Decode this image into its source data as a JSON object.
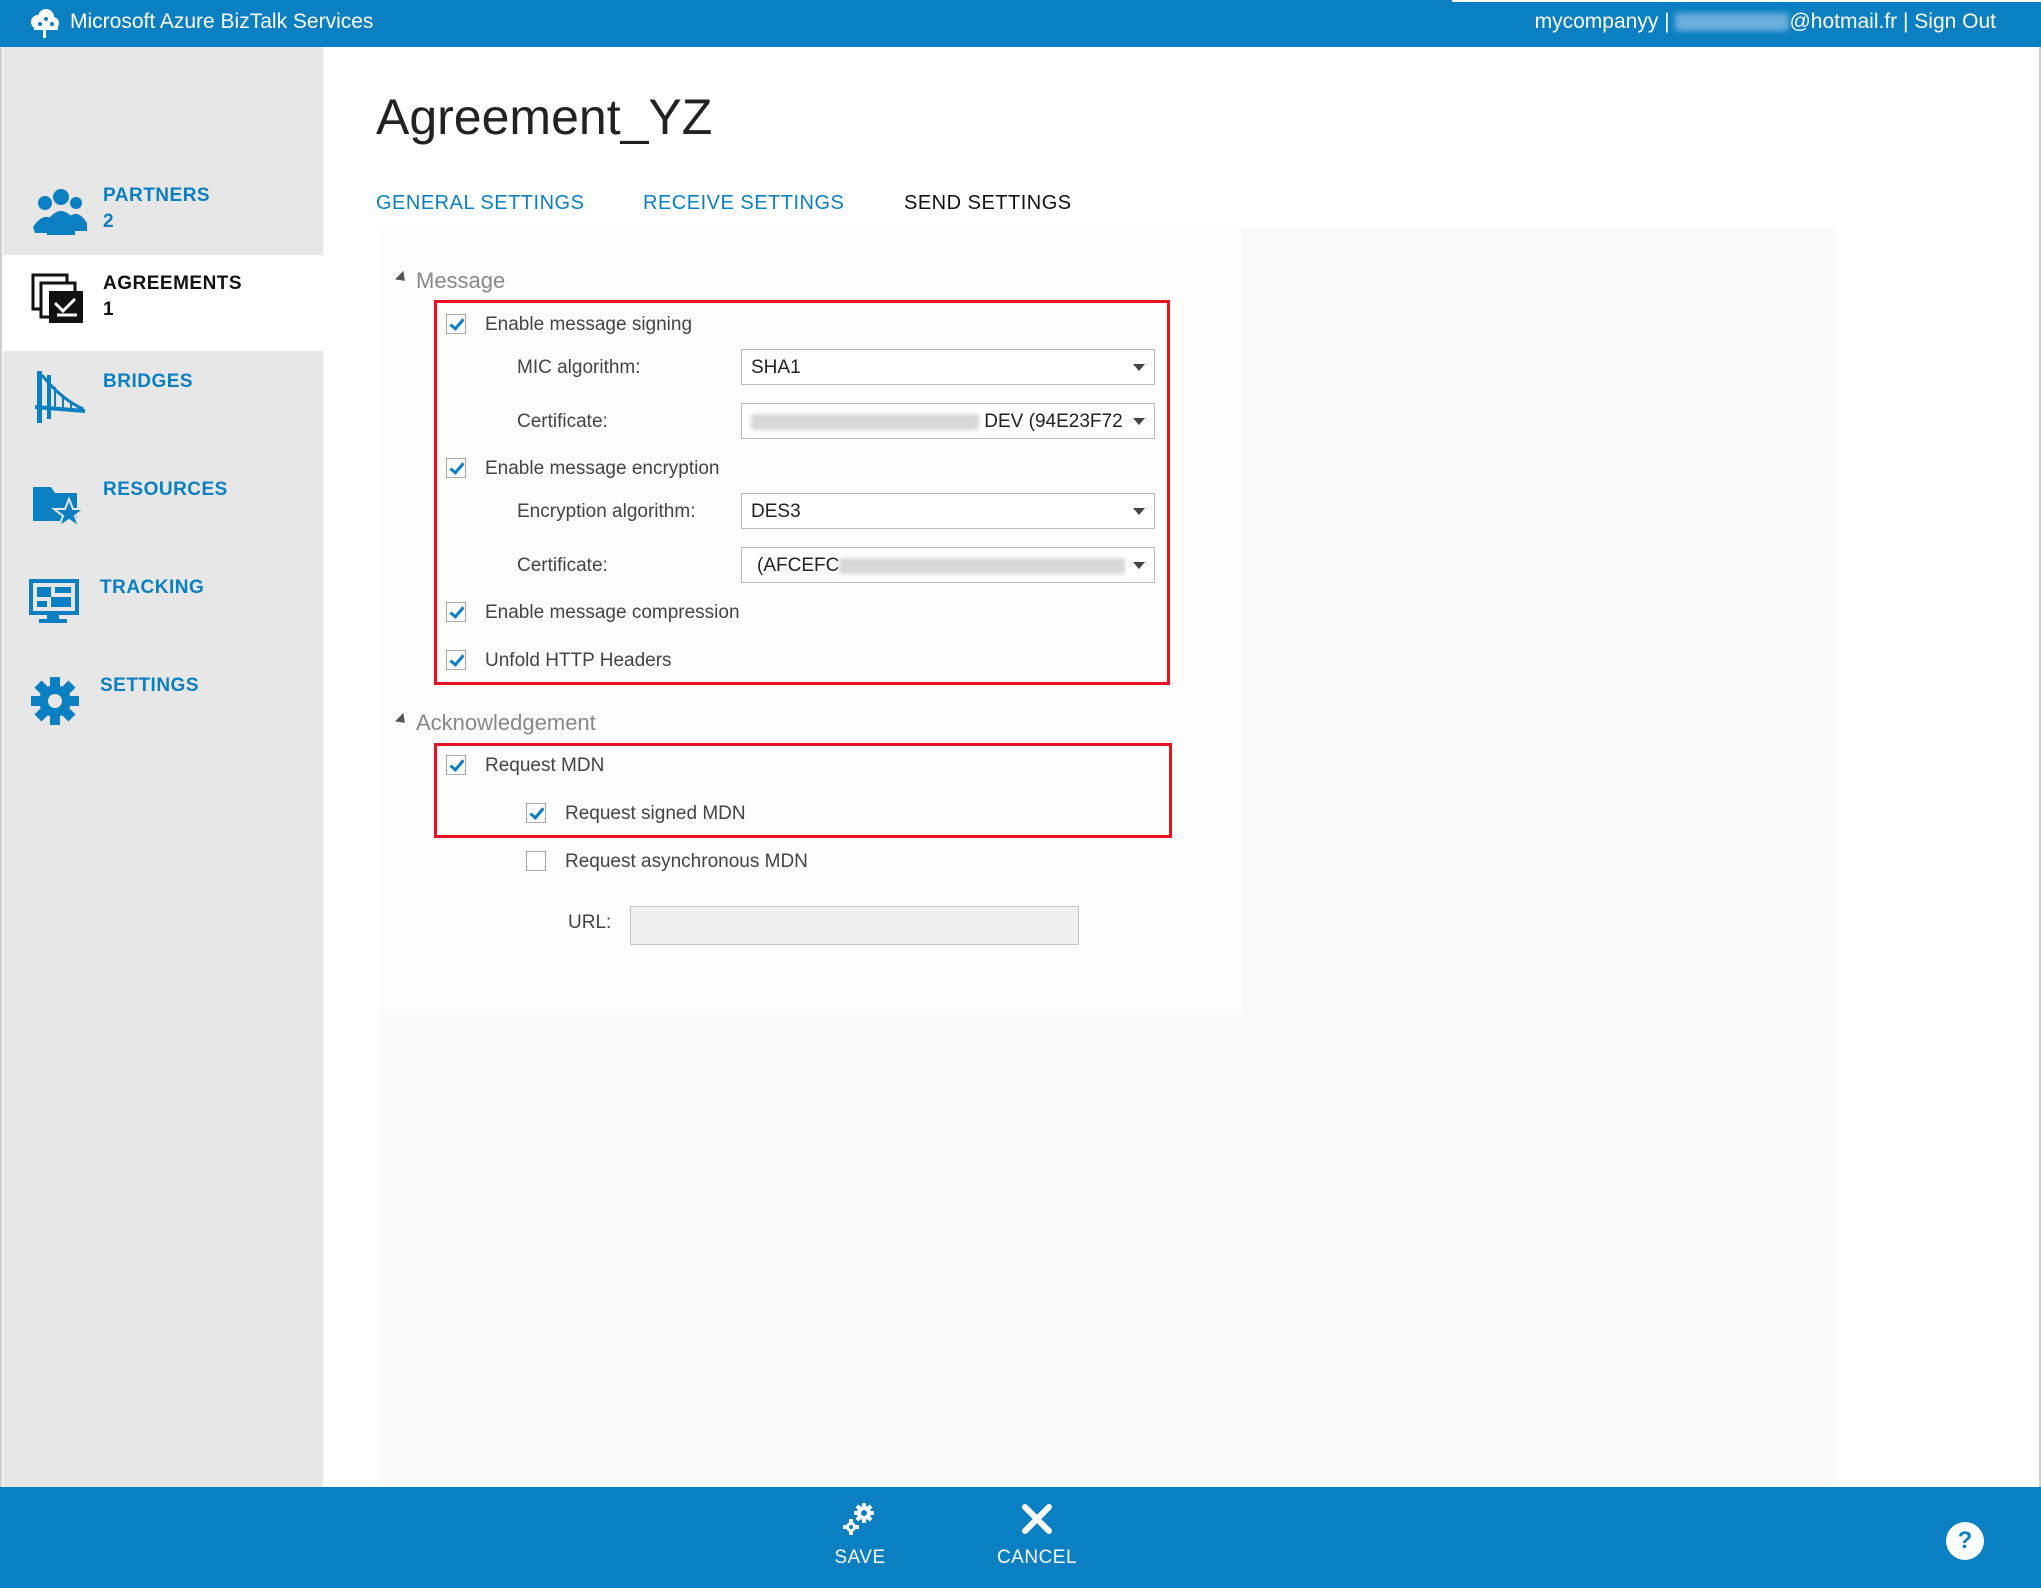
{
  "header": {
    "app_title": "Microsoft Azure BizTalk Services",
    "account_prefix": "mycompanyy |",
    "account_suffix": "@hotmail.fr |",
    "sign_out": "Sign Out"
  },
  "sidebar": {
    "items": [
      {
        "label": "PARTNERS",
        "count": "2",
        "icon": "partners-icon"
      },
      {
        "label": "AGREEMENTS",
        "count": "1",
        "icon": "agreements-icon",
        "active": true
      },
      {
        "label": "BRIDGES",
        "count": "",
        "icon": "bridge-icon"
      },
      {
        "label": "RESOURCES",
        "count": "",
        "icon": "resources-icon"
      },
      {
        "label": "TRACKING",
        "count": "",
        "icon": "tracking-icon"
      },
      {
        "label": "SETTINGS",
        "count": "",
        "icon": "gear-icon"
      }
    ]
  },
  "page": {
    "title": "Agreement_YZ",
    "tabs": [
      {
        "label": "GENERAL SETTINGS"
      },
      {
        "label": "RECEIVE SETTINGS"
      },
      {
        "label": "SEND SETTINGS",
        "active": true
      }
    ]
  },
  "message": {
    "section_title": "Message",
    "enable_signing": {
      "label": "Enable message signing",
      "checked": true
    },
    "mic_algorithm": {
      "label": "MIC algorithm:",
      "value": "SHA1"
    },
    "signing_certificate": {
      "label": "Certificate:",
      "value_visible": "DEV (94E23F72"
    },
    "enable_encryption": {
      "label": "Enable message encryption",
      "checked": true
    },
    "encryption_algorithm": {
      "label": "Encryption algorithm:",
      "value": "DES3"
    },
    "encryption_certificate": {
      "label": "Certificate:",
      "value_visible": "(AFCEFC"
    },
    "enable_compression": {
      "label": "Enable message compression",
      "checked": true
    },
    "unfold_headers": {
      "label": "Unfold HTTP Headers",
      "checked": true
    }
  },
  "acknowledgement": {
    "section_title": "Acknowledgement",
    "request_mdn": {
      "label": "Request MDN",
      "checked": true
    },
    "request_signed_mdn": {
      "label": "Request signed MDN",
      "checked": true
    },
    "request_async_mdn": {
      "label": "Request asynchronous MDN",
      "checked": false
    },
    "url": {
      "label": "URL:",
      "value": ""
    }
  },
  "footer": {
    "save": "SAVE",
    "cancel": "CANCEL",
    "help": "?"
  },
  "colors": {
    "accent": "#0a7fc1",
    "highlight": "#e81123",
    "sidebar_bg": "#e7e7e7"
  }
}
